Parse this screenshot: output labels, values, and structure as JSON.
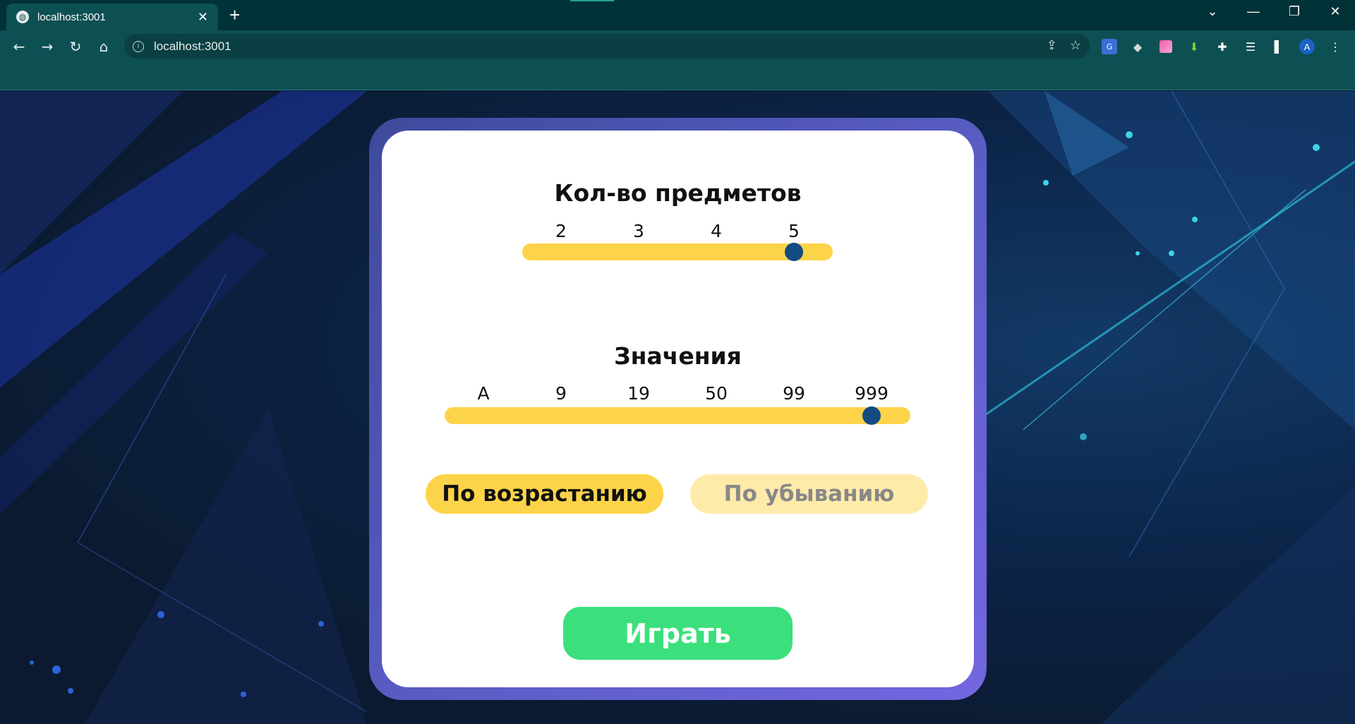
{
  "browser": {
    "tab_title": "localhost:3001",
    "url": "localhost:3001",
    "profile_initial": "A"
  },
  "game": {
    "count_section": {
      "title": "Кол-во предметов",
      "ticks": [
        "2",
        "3",
        "4",
        "5"
      ],
      "selected": "5"
    },
    "values_section": {
      "title": "Значения",
      "ticks": [
        "A",
        "9",
        "19",
        "50",
        "99",
        "999"
      ],
      "selected": "999"
    },
    "sort": {
      "ascending_label": "По возрастанию",
      "descending_label": "По убыванию",
      "active": "ascending"
    },
    "play_label": "Играть"
  },
  "colors": {
    "track": "#fdd449",
    "thumb": "#124c82",
    "play": "#3be07c",
    "card_frame": "#5d5fc9"
  }
}
